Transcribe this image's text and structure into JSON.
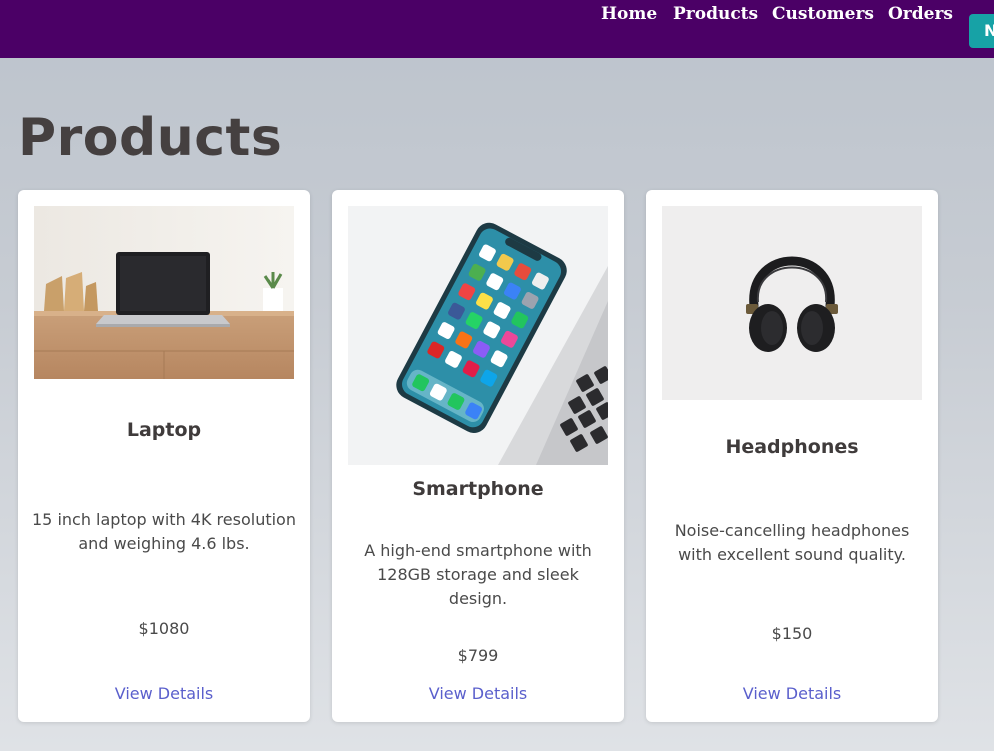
{
  "nav": {
    "items": [
      {
        "label": "Home"
      },
      {
        "label": "Products"
      },
      {
        "label": "Customers"
      },
      {
        "label": "Orders"
      }
    ],
    "button_label": "N",
    "bar_color": "#4b0066",
    "button_color": "#17a2a6"
  },
  "page": {
    "title": "Products"
  },
  "products": [
    {
      "name": "Laptop",
      "description": "15 inch laptop with 4K resolution and weighing 4.6 lbs.",
      "price": "$1080",
      "link": "View Details",
      "image": "laptop-photo"
    },
    {
      "name": "Smartphone",
      "description": "A high-end smartphone with 128GB storage and sleek design.",
      "price": "$799",
      "link": "View Details",
      "image": "smartphone-photo"
    },
    {
      "name": "Headphones",
      "description": "Noise-cancelling headphones with excellent sound quality.",
      "price": "$150",
      "link": "View Details",
      "image": "headphones-photo"
    }
  ],
  "colors": {
    "link": "#5a5fcc",
    "title": "#454040"
  }
}
